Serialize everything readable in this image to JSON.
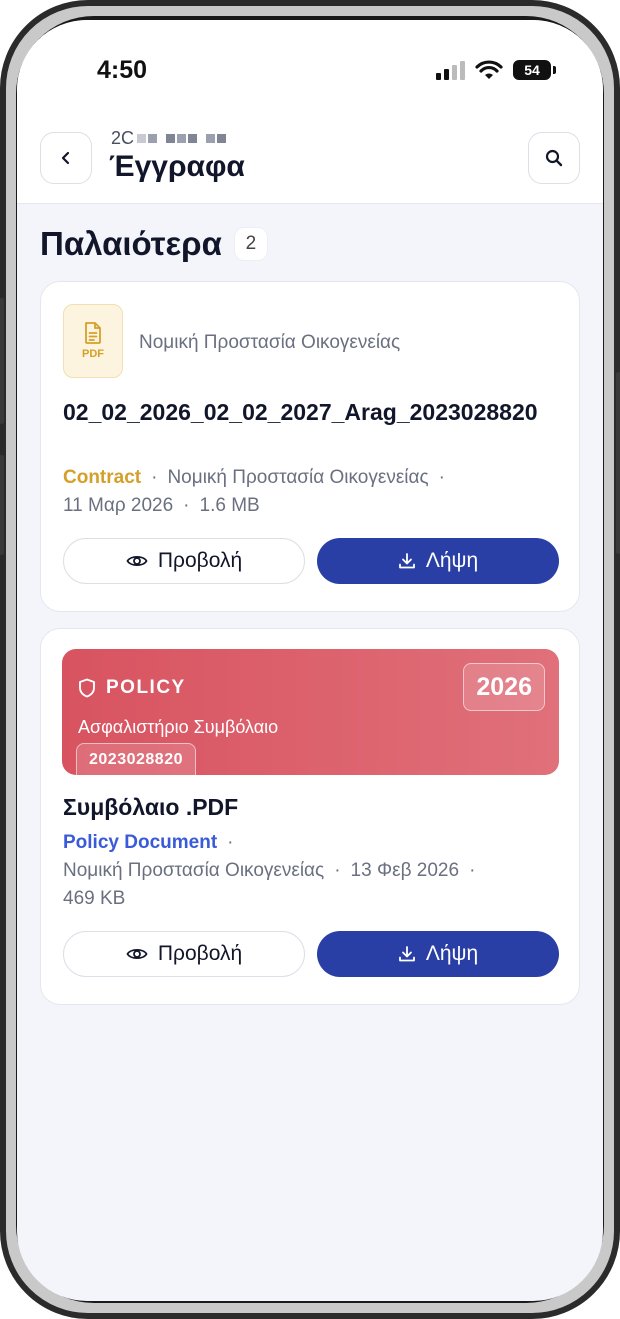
{
  "status": {
    "time": "4:50",
    "battery": "54"
  },
  "header": {
    "subtitle_prefix": "2C",
    "title": "Έγγραφα"
  },
  "section": {
    "title": "Παλαιότερα",
    "count": "2"
  },
  "documents": [
    {
      "file_badge": "PDF",
      "category": "Νομική Προστασία Οικογενείας",
      "title": "02_02_2026_02_02_2027_Arag_2023028820",
      "type": "Contract",
      "type_color": "#d4a02a",
      "product": "Νομική Προστασία Οικογενείας",
      "date": "11 Μαρ 2026",
      "size": "1.6 MB",
      "view_label": "Προβολή",
      "download_label": "Λήψη"
    },
    {
      "banner_label": "POLICY",
      "banner_year": "2026",
      "banner_subtitle": "Ασφαλιστήριο Συμβόλαιο",
      "banner_number": "2023028820",
      "title": "Συμβόλαιο .PDF",
      "type": "Policy Document",
      "type_color": "#3a5bd9",
      "product": "Νομική Προστασία Οικογενείας",
      "date": "13 Φεβ 2026",
      "size": "469 KB",
      "view_label": "Προβολή",
      "download_label": "Λήψη"
    }
  ],
  "colors": {
    "primary": "#2a3fa6",
    "policy_banner": "#d85360",
    "background": "#f4f5fb"
  },
  "icons": {
    "back": "chevron-left-icon",
    "search": "search-icon",
    "pdf": "document-icon",
    "view": "eye-icon",
    "download": "download-icon",
    "policy": "shield-icon"
  }
}
